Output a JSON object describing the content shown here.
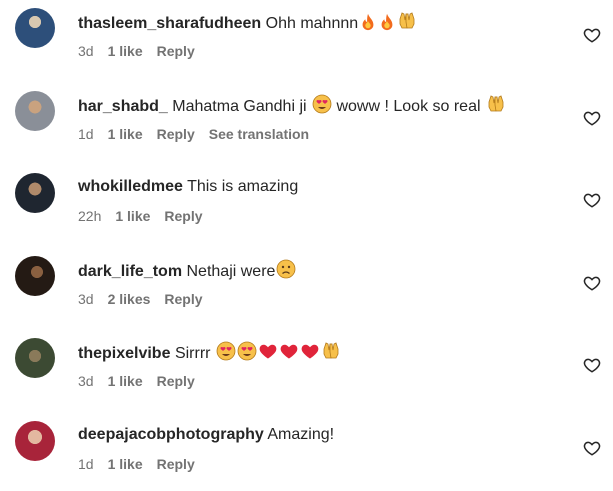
{
  "comments": [
    {
      "username": "thasleem_sharafudheen",
      "text": "Ohh mahnnn",
      "emojis": [
        "fire",
        "fire",
        "raising-hands"
      ],
      "time": "3d",
      "likes": "1 like",
      "reply": "Reply",
      "avatar": "#3a5a8a"
    },
    {
      "username": "har_shabd_",
      "text": "Mahatma Gandhi ji",
      "emojis_mid": [
        "heart-eyes"
      ],
      "text2": "woww ! Look so real",
      "emojis": [
        "raising-hands"
      ],
      "time": "1d",
      "likes": "1 like",
      "reply": "Reply",
      "translate": "See translation",
      "avatar": "#7b6b57"
    },
    {
      "username": "whokilledmee",
      "text": "This is amazing",
      "emojis": [],
      "time": "22h",
      "likes": "1 like",
      "reply": "Reply",
      "avatar": "#2e3440"
    },
    {
      "username": "dark_life_tom",
      "text": "Nethaji were",
      "emojis": [
        "sad-face"
      ],
      "time": "3d",
      "likes": "2 likes",
      "reply": "Reply",
      "avatar": "#3b2a20"
    },
    {
      "username": "thepixelvibe",
      "text": "Sirrrr",
      "emojis": [
        "heart-eyes",
        "heart-eyes",
        "red-heart",
        "red-heart",
        "red-heart",
        "raising-hands"
      ],
      "time": "3d",
      "likes": "1 like",
      "reply": "Reply",
      "avatar": "#4a5a3a"
    },
    {
      "username": "deepajacobphotography",
      "text": "Amazing!",
      "emojis": [],
      "time": "1d",
      "likes": "1 like",
      "reply": "Reply",
      "avatar": "#b5343f"
    }
  ],
  "heart_icon": "heart-outline-icon"
}
